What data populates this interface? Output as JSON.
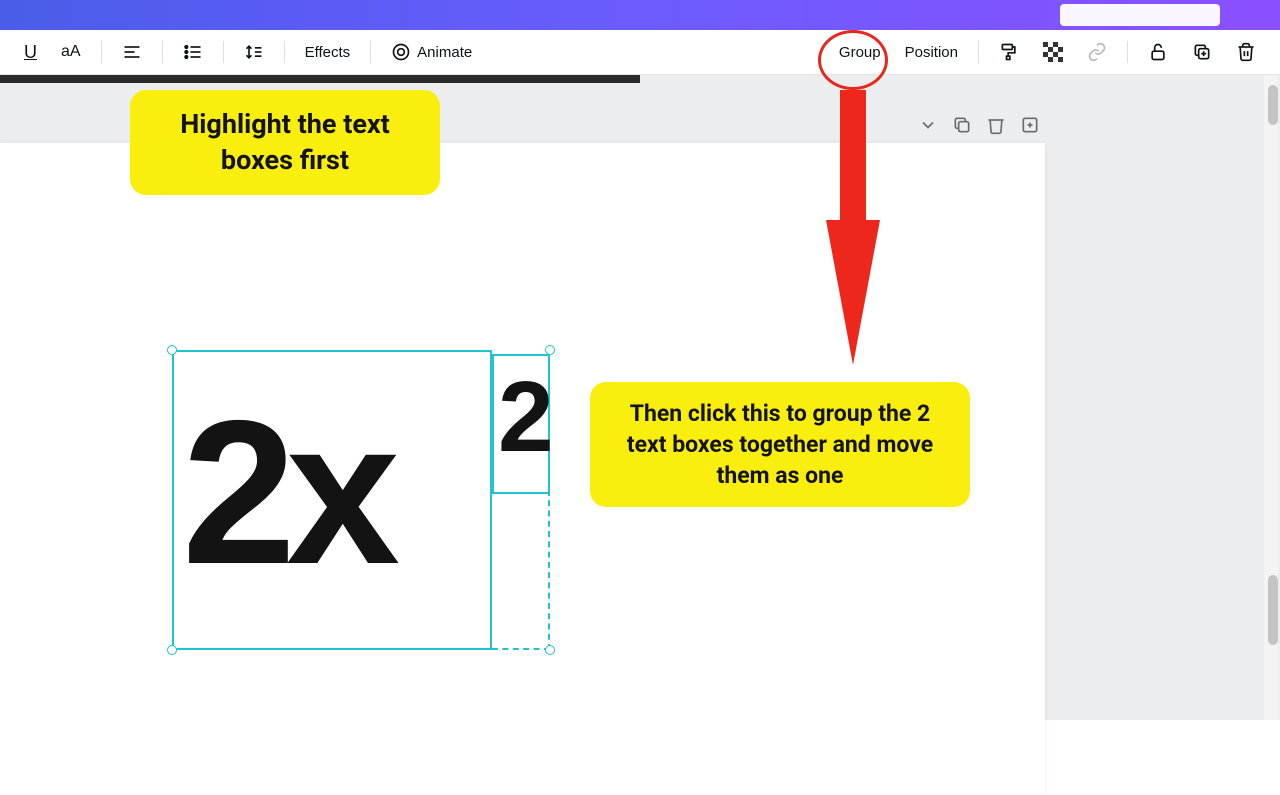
{
  "toolbar": {
    "underline": "U",
    "case": "aA",
    "effects": "Effects",
    "animate": "Animate",
    "group": "Group",
    "position": "Position"
  },
  "callouts": {
    "highlight": "Highlight the text boxes first",
    "group_hint": "Then click this to group the 2 text boxes together and move them as one"
  },
  "canvas": {
    "main_text": "2x",
    "superscript": "2"
  }
}
